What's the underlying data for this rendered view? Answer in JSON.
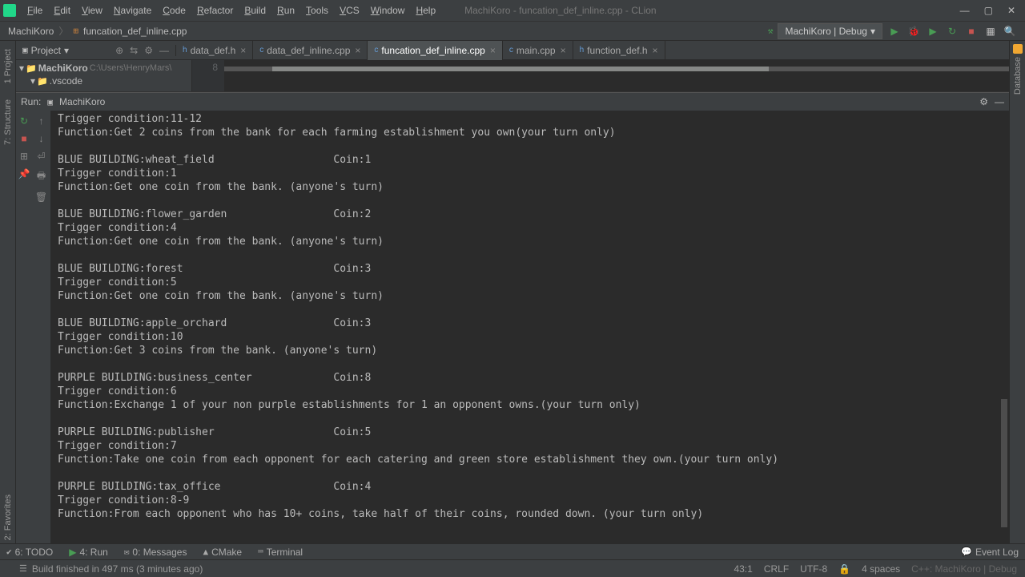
{
  "title": "MachiKoro - funcation_def_inline.cpp - CLion",
  "menus": [
    "File",
    "Edit",
    "View",
    "Navigate",
    "Code",
    "Refactor",
    "Build",
    "Run",
    "Tools",
    "VCS",
    "Window",
    "Help"
  ],
  "breadcrumb": {
    "project": "MachiKoro",
    "file": "funcation_def_inline.cpp"
  },
  "run_config": "MachiKoro | Debug",
  "project_label": "Project",
  "tree": {
    "root": "MachiKoro",
    "root_path": "C:\\Users\\HenryMars\\",
    "child": ".vscode"
  },
  "tabs": [
    {
      "name": "data_def.h",
      "active": false
    },
    {
      "name": "data_def_inline.cpp",
      "active": false
    },
    {
      "name": "funcation_def_inline.cpp",
      "active": true
    },
    {
      "name": "main.cpp",
      "active": false
    },
    {
      "name": "function_def.h",
      "active": false
    }
  ],
  "gutter_line": "8",
  "run_label": "Run:",
  "run_target": "MachiKoro",
  "left_labels": {
    "project": "1 Project",
    "structure": "7: Structure",
    "favorites": "2: Favorites"
  },
  "right_labels": {
    "database": "Database"
  },
  "console_lines": [
    "Trigger condition:11-12",
    "Function:Get 2 coins from the bank for each farming establishment you own(your turn only)",
    "",
    "BLUE BUILDING:wheat_field                   Coin:1",
    "Trigger condition:1",
    "Function:Get one coin from the bank. (anyone's turn)",
    "",
    "BLUE BUILDING:flower_garden                 Coin:2",
    "Trigger condition:4",
    "Function:Get one coin from the bank. (anyone's turn)",
    "",
    "BLUE BUILDING:forest                        Coin:3",
    "Trigger condition:5",
    "Function:Get one coin from the bank. (anyone's turn)",
    "",
    "BLUE BUILDING:apple_orchard                 Coin:3",
    "Trigger condition:10",
    "Function:Get 3 coins from the bank. (anyone's turn)",
    "",
    "PURPLE BUILDING:business_center             Coin:8",
    "Trigger condition:6",
    "Function:Exchange 1 of your non purple establishments for 1 an opponent owns.(your turn only)",
    "",
    "PURPLE BUILDING:publisher                   Coin:5",
    "Trigger condition:7",
    "Function:Take one coin from each opponent for each catering and green store establishment they own.(your turn only)",
    "",
    "PURPLE BUILDING:tax_office                  Coin:4",
    "Trigger condition:8-9",
    "Function:From each opponent who has 10+ coins, take half of their coins, rounded down. (your turn only)"
  ],
  "bottom": {
    "todo": "6: TODO",
    "run": "4: Run",
    "messages": "0: Messages",
    "cmake": "CMake",
    "terminal": "Terminal",
    "eventlog": "Event Log"
  },
  "status": {
    "msg": "Build finished in 497 ms (3 minutes ago)",
    "pos": "43:1",
    "eol": "CRLF",
    "enc": "UTF-8",
    "indent": "4 spaces",
    "ctx": "C++: MachiKoro | Debug"
  }
}
